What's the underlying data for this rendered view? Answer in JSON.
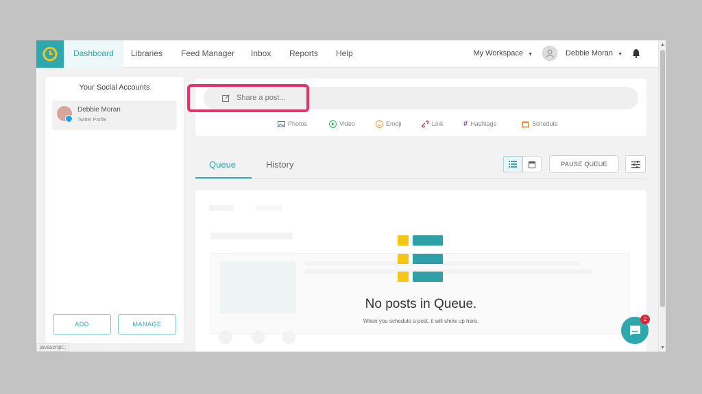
{
  "nav": {
    "items": [
      {
        "label": "Dashboard",
        "active": true
      },
      {
        "label": "Libraries"
      },
      {
        "label": "Feed Manager"
      },
      {
        "label": "Inbox"
      },
      {
        "label": "Reports"
      },
      {
        "label": "Help"
      }
    ],
    "workspace": "My Workspace",
    "user_name": "Debbie Moran"
  },
  "sidebar": {
    "title": "Your Social Accounts",
    "account": {
      "name": "Debbie Moran",
      "type": "Twitter Profile"
    },
    "add_label": "ADD",
    "manage_label": "MANAGE"
  },
  "composer": {
    "placeholder": "Share a post...",
    "attachments": [
      {
        "label": "Photos",
        "icon": "photo-icon"
      },
      {
        "label": "Video",
        "icon": "video-icon"
      },
      {
        "label": "Emoji",
        "icon": "emoji-icon"
      },
      {
        "label": "Link",
        "icon": "link-icon"
      },
      {
        "label": "Hashtags",
        "icon": "hashtag-icon"
      },
      {
        "label": "Schedule",
        "icon": "schedule-icon"
      }
    ]
  },
  "tabs": {
    "queue": "Queue",
    "history": "History",
    "pause_label": "PAUSE QUEUE"
  },
  "queue": {
    "empty_title": "No posts in Queue.",
    "empty_sub": "When you schedule a post, it will show up here."
  },
  "chat": {
    "badge": "2"
  },
  "status": {
    "url": "javascript:;"
  },
  "colors": {
    "accent": "#2ea7ad",
    "highlight": "#e3326e",
    "empty_square": "#f5c518",
    "empty_bar": "#2ea0a6",
    "badge": "#e0243a"
  }
}
